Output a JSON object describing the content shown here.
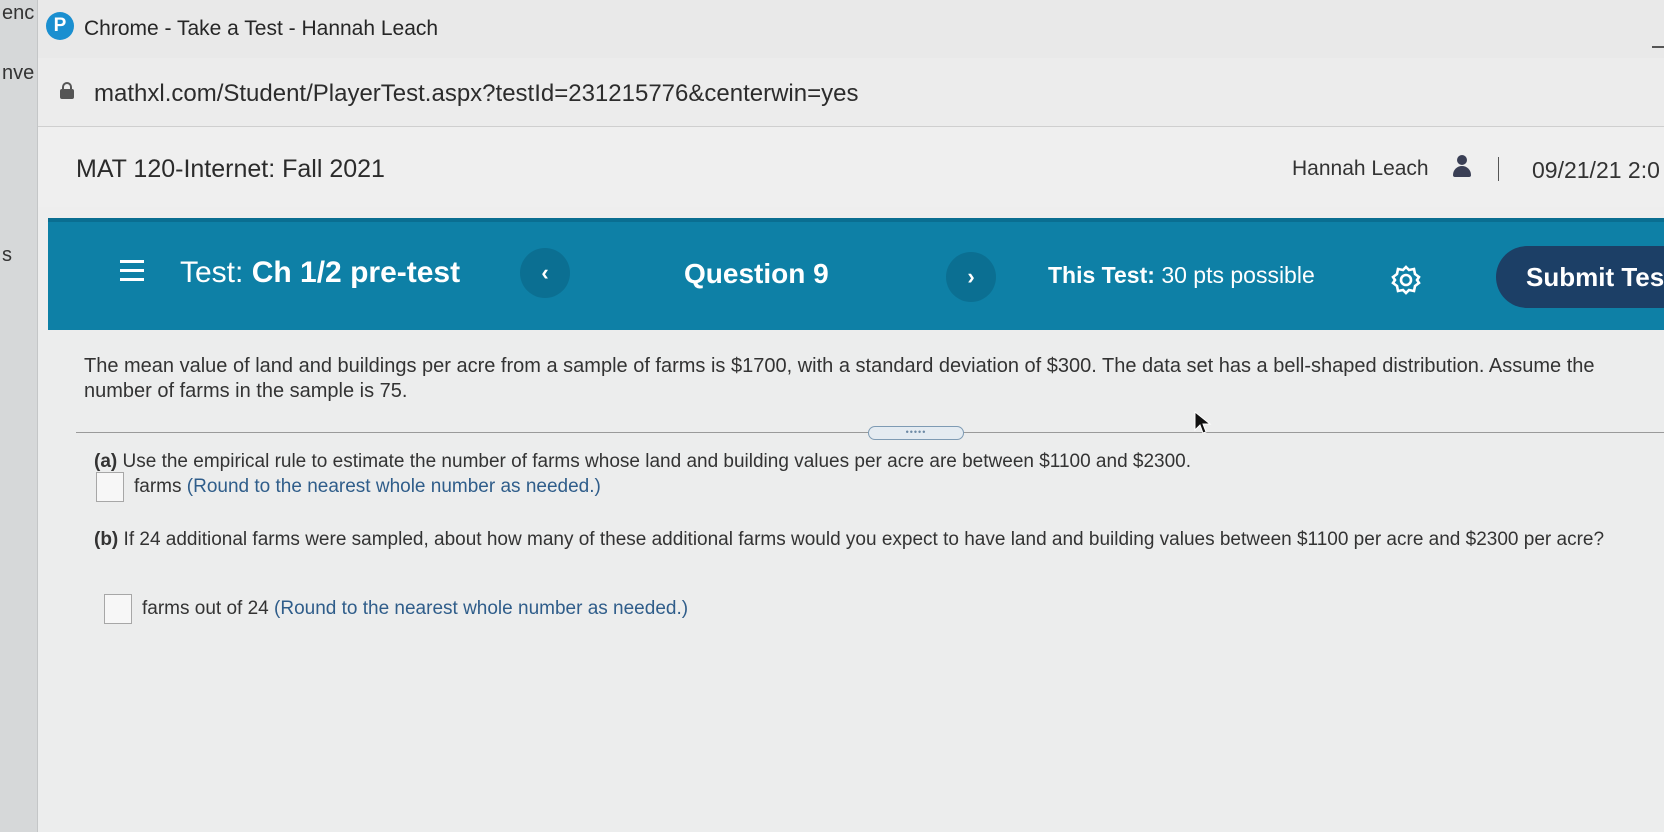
{
  "left_strip": {
    "top_text": "enc",
    "mid_text": "nve",
    "low_text": "s"
  },
  "titlebar": {
    "icon_letter": "P",
    "title": "Chrome - Take a Test - Hannah Leach"
  },
  "urlbar": {
    "url": "mathxl.com/Student/PlayerTest.aspx?testId=231215776&centerwin=yes"
  },
  "course_header": {
    "course_title": "MAT 120-Internet: Fall 2021",
    "user_name": "Hannah Leach",
    "date": "09/21/21 2:0"
  },
  "navbar": {
    "test_prefix": "Test:",
    "test_name": "Ch 1/2 pre-test",
    "prev_label": "‹",
    "question_label": "Question 9",
    "next_label": "›",
    "this_test_prefix": "This Test:",
    "this_test_value": "30 pts possible",
    "submit_label": "Submit Test"
  },
  "problem": {
    "statement": "The mean value of land and buildings per acre from a sample of farms is $1700, with a standard deviation of $300. The data set has a bell-shaped distribution. Assume the number of farms in the sample is 75.",
    "handle_dots": "•••••"
  },
  "part_a": {
    "label": "(a)",
    "question": "Use the empirical rule to estimate the number of farms whose land and building values per acre are between $1100 and $2300.",
    "answer_value": "",
    "unit": "farms",
    "hint": "(Round to the nearest whole number as needed.)"
  },
  "part_b": {
    "label": "(b)",
    "question": "If 24 additional farms were sampled, about how many of these additional farms would you expect to have land and building values between $1100 per acre and $2300 per acre?",
    "answer_value": "",
    "unit": "farms out of 24",
    "hint": "(Round to the nearest whole number as needed.)"
  },
  "colors": {
    "navbar": "#0e80a6",
    "submit_button": "#1c3f66",
    "hint_text": "#2f5d8a"
  }
}
